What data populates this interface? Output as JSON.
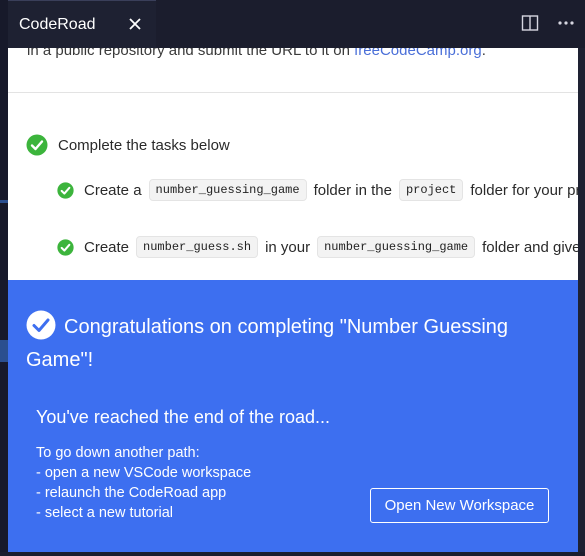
{
  "tab": {
    "title": "CodeRoad"
  },
  "colors": {
    "banner": "#3d6ff0",
    "check": "#3cb43c",
    "link": "#4a6fd8"
  },
  "content": {
    "intro_prefix": "in a public repository and submit the URL to it on",
    "intro_link": "freeCodeCamp.org",
    "intro_suffix": ".",
    "tasks_heading": "Complete the tasks below",
    "tasks": [
      {
        "pre": "Create a",
        "code1": "number_guessing_game",
        "mid": "folder in the",
        "code2": "project",
        "post": "folder for your prog"
      },
      {
        "pre": "Create",
        "code1": "number_guess.sh",
        "mid": "in your",
        "code2": "number_guessing_game",
        "post": "folder and give it e"
      }
    ]
  },
  "banner": {
    "title": "Congratulations on completing \"Number Guessing Game\"!",
    "subtitle": "You've reached the end of the road...",
    "lines": [
      "To go down another path:",
      "- open a new VSCode workspace",
      "- relaunch the CodeRoad app",
      "- select a new tutorial"
    ],
    "button_label": "Open New Workspace"
  },
  "icons": {
    "close": "close-icon",
    "split": "split-editor-icon",
    "more": "more-actions-icon",
    "check": "check-circle-icon"
  }
}
